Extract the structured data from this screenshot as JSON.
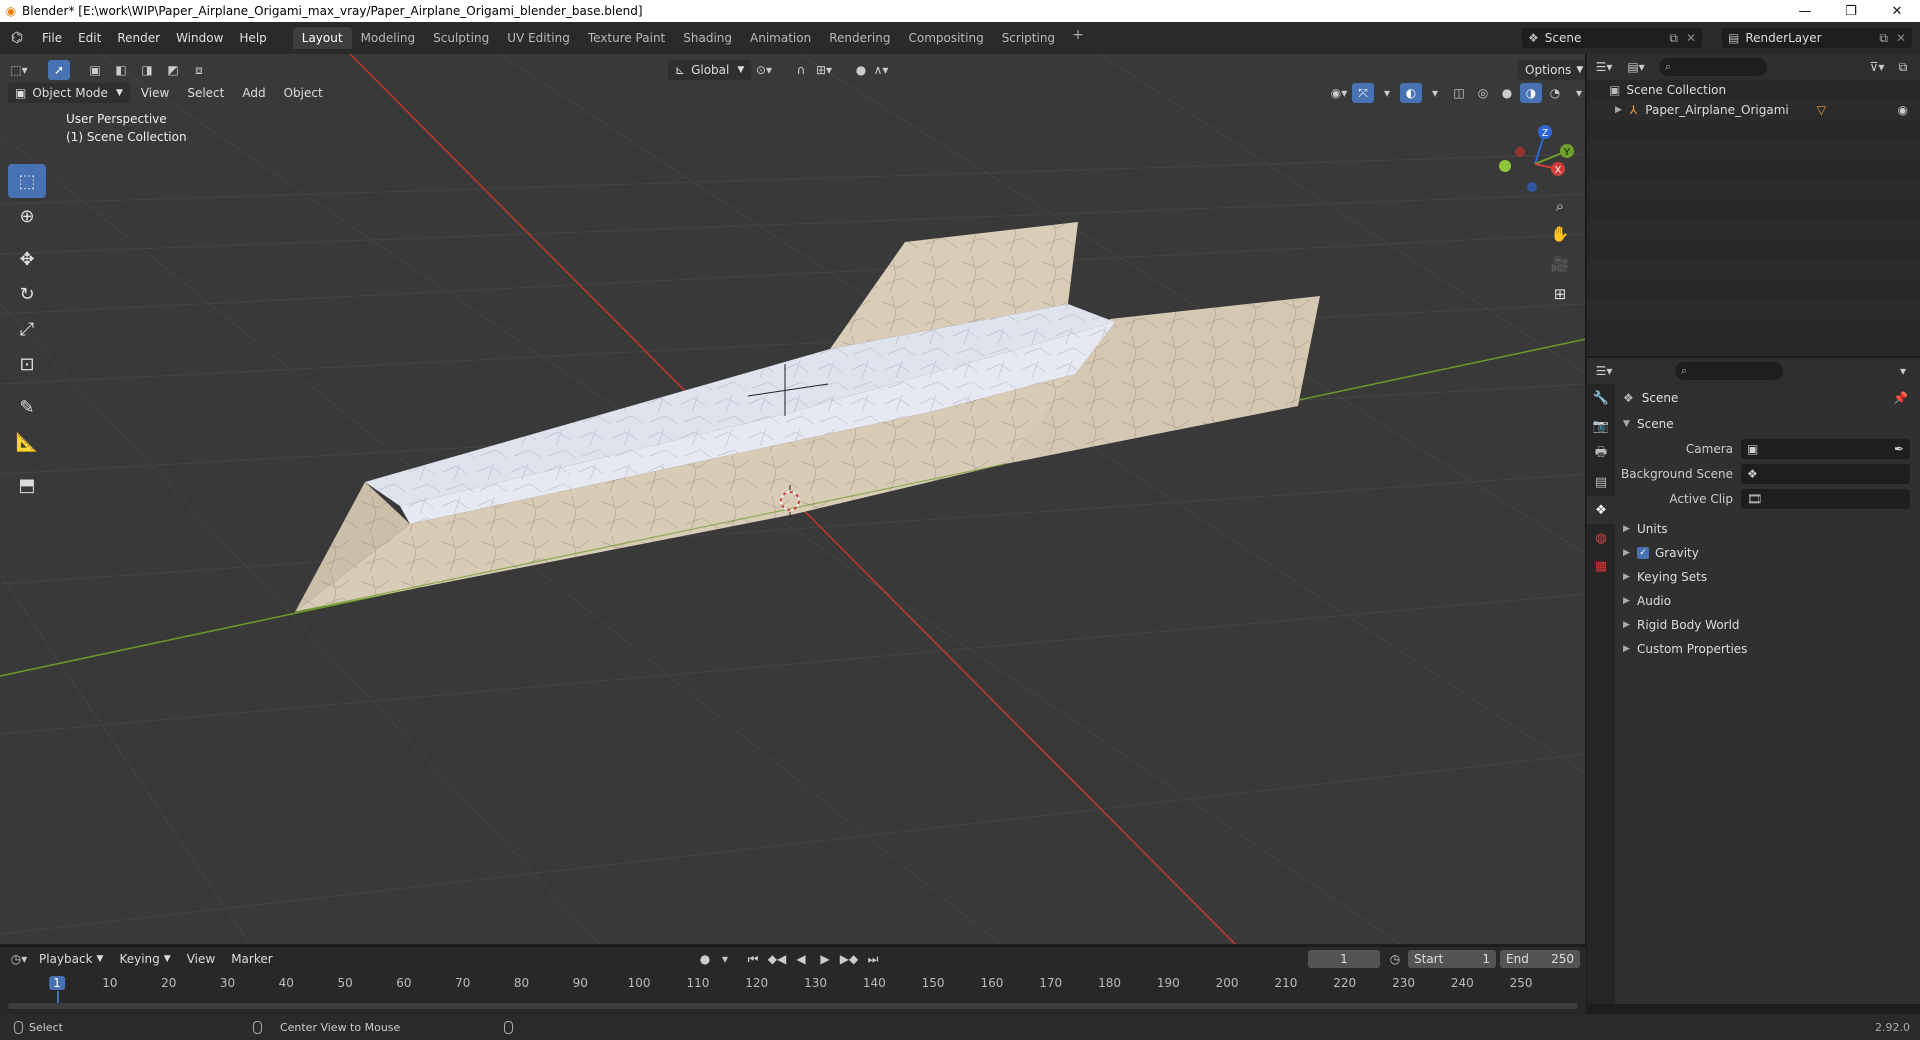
{
  "window": {
    "title": "Blender* [E:\\work\\WIP\\Paper_Airplane_Origami_max_vray/Paper_Airplane_Origami_blender_base.blend]",
    "minimize": "—",
    "maximize": "❐",
    "close": "✕"
  },
  "menu": [
    "File",
    "Edit",
    "Render",
    "Window",
    "Help"
  ],
  "workspaces": {
    "active": "Layout",
    "tabs": [
      "Layout",
      "Modeling",
      "Sculpting",
      "UV Editing",
      "Texture Paint",
      "Shading",
      "Animation",
      "Rendering",
      "Compositing",
      "Scripting"
    ],
    "add": "+"
  },
  "scene_selector": {
    "scene": "Scene",
    "view_layer": "RenderLayer"
  },
  "viewport": {
    "mode": "Object Mode",
    "menus": [
      "View",
      "Select",
      "Add",
      "Object"
    ],
    "transform_orientation": "Global",
    "options_label": "Options",
    "info_line1": "User Perspective",
    "info_line2": "(1) Scene Collection",
    "gizmo_labels": {
      "x": "X",
      "y": "Y",
      "z": "Z"
    }
  },
  "toolbar": {
    "tools": [
      "select-box",
      "cursor",
      "move",
      "rotate",
      "scale",
      "transform",
      "annotate",
      "measure",
      "add-cube"
    ],
    "active": "select-box"
  },
  "outliner": {
    "root": "Scene Collection",
    "items": [
      {
        "name": "Paper_Airplane_Origami"
      }
    ]
  },
  "properties": {
    "context_title": "Scene",
    "panel_title": "Scene",
    "fields": [
      {
        "label": "Camera",
        "value": ""
      },
      {
        "label": "Background Scene",
        "value": ""
      },
      {
        "label": "Active Clip",
        "value": ""
      }
    ],
    "sections": [
      "Units",
      "Gravity",
      "Keying Sets",
      "Audio",
      "Rigid Body World",
      "Custom Properties"
    ],
    "gravity_checked": true
  },
  "timeline": {
    "menus": [
      "Playback",
      "Keying",
      "View",
      "Marker"
    ],
    "current_frame": "1",
    "start_label": "Start",
    "start": "1",
    "end_label": "End",
    "end": "250",
    "ruler": [
      "1",
      "10",
      "20",
      "30",
      "40",
      "50",
      "60",
      "70",
      "80",
      "90",
      "100",
      "110",
      "120",
      "130",
      "140",
      "150",
      "160",
      "170",
      "180",
      "190",
      "200",
      "210",
      "220",
      "230",
      "240",
      "250"
    ]
  },
  "statusbar": {
    "select": "Select",
    "center_view": "Center View to Mouse",
    "version": "2.92.0"
  },
  "colors": {
    "accent": "#4772b3",
    "x_axis": "#c0392b",
    "y_axis": "#6c9a2a",
    "paper": "#d9cdb8",
    "paper_light": "#dfe3ee"
  }
}
